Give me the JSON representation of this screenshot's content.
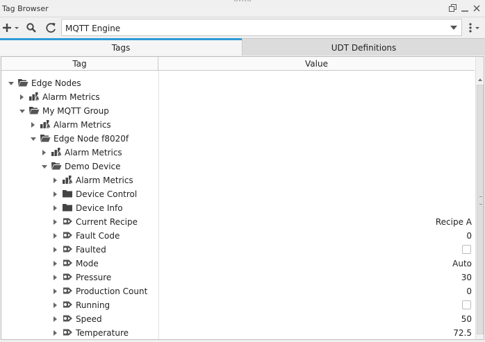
{
  "window": {
    "title": "Tag Browser"
  },
  "toolbar": {
    "provider": "MQTT Engine"
  },
  "tabs": [
    {
      "label": "Tags"
    },
    {
      "label": "UDT Definitions"
    }
  ],
  "table": {
    "headers": {
      "tag": "Tag",
      "value": "Value"
    },
    "rows": [
      {
        "label": "Edge Nodes",
        "level": 0,
        "expander": "expanded",
        "icon": "folder-open"
      },
      {
        "label": "Alarm Metrics",
        "level": 1,
        "expander": "collapsed",
        "icon": "alarm-metrics"
      },
      {
        "label": "My MQTT Group",
        "level": 1,
        "expander": "expanded",
        "icon": "folder-open"
      },
      {
        "label": "Alarm Metrics",
        "level": 2,
        "expander": "collapsed",
        "icon": "alarm-metrics"
      },
      {
        "label": "Edge Node f8020f",
        "level": 2,
        "expander": "expanded",
        "icon": "folder-open"
      },
      {
        "label": "Alarm Metrics",
        "level": 3,
        "expander": "collapsed",
        "icon": "alarm-metrics"
      },
      {
        "label": "Demo Device",
        "level": 3,
        "expander": "expanded",
        "icon": "folder-open"
      },
      {
        "label": "Alarm Metrics",
        "level": 4,
        "expander": "collapsed",
        "icon": "alarm-metrics"
      },
      {
        "label": "Device Control",
        "level": 4,
        "expander": "collapsed",
        "icon": "folder"
      },
      {
        "label": "Device Info",
        "level": 4,
        "expander": "collapsed",
        "icon": "folder"
      },
      {
        "label": "Current Recipe",
        "level": 4,
        "expander": "collapsed",
        "icon": "tag",
        "value": "Recipe A"
      },
      {
        "label": "Fault Code",
        "level": 4,
        "expander": "collapsed",
        "icon": "tag",
        "value": "0"
      },
      {
        "label": "Faulted",
        "level": 4,
        "expander": "collapsed",
        "icon": "tag",
        "checkbox": false
      },
      {
        "label": "Mode",
        "level": 4,
        "expander": "collapsed",
        "icon": "tag",
        "value": "Auto"
      },
      {
        "label": "Pressure",
        "level": 4,
        "expander": "collapsed",
        "icon": "tag",
        "value": "30"
      },
      {
        "label": "Production Count",
        "level": 4,
        "expander": "collapsed",
        "icon": "tag",
        "value": "0"
      },
      {
        "label": "Running",
        "level": 4,
        "expander": "collapsed",
        "icon": "tag",
        "checkbox": false
      },
      {
        "label": "Speed",
        "level": 4,
        "expander": "collapsed",
        "icon": "tag",
        "value": "50"
      },
      {
        "label": "Temperature",
        "level": 4,
        "expander": "collapsed",
        "icon": "tag",
        "value": "72.5"
      }
    ]
  },
  "colors": {
    "accent": "#2e9ad6",
    "icon": "#555555"
  }
}
